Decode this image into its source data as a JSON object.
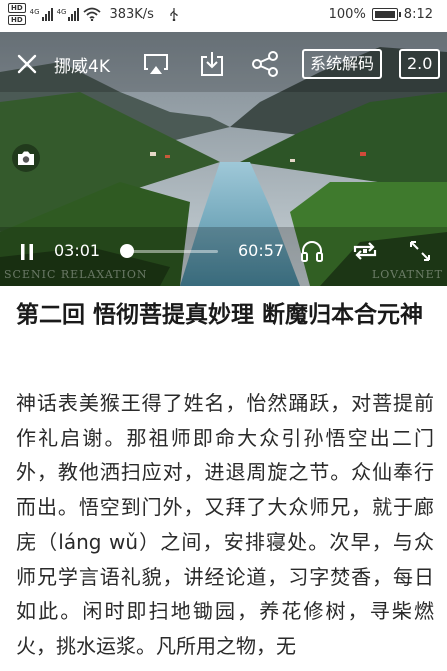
{
  "status_bar": {
    "hd_label": "HD",
    "sim1_tag": "4G",
    "sim2_tag": "4G",
    "network_speed": "383K/s",
    "battery_percent_text": "100%",
    "battery_level": 1.0,
    "time": "8:12"
  },
  "video": {
    "title": "挪威4K",
    "decode_button": "系统解码",
    "speed_button": "2.0",
    "current_time": "03:01",
    "duration": "60:57",
    "progress_fraction": 0.05,
    "watermark_left": "SCENIC RELAXATION",
    "watermark_right": "LOVATNET",
    "icons": {
      "close": "close-icon",
      "cast": "cast-icon",
      "download": "download-icon",
      "share": "share-icon",
      "screenshot": "camera-icon",
      "pause": "pause-icon",
      "headphones": "headphones-icon",
      "loop": "loop-icon",
      "fullscreen": "fullscreen-icon"
    }
  },
  "chapter": {
    "title": "第二回 悟彻菩提真妙理 断魔归本合元神",
    "body": "神话表美猴王得了姓名，怡然踊跃，对菩提前作礼启谢。那祖师即命大众引孙悟空出二门外，教他洒扫应对，进退周旋之节。众仙奉行而出。悟空到门外，又拜了大众师兄，就于廊庑（láng wǔ）之间，安排寝处。次早，与众师兄学言语礼貌，讲经论道，习字焚香，每日如此。闲时即扫地锄园，养花修树，寻柴燃火，挑水运浆。凡所用之物，无"
  }
}
